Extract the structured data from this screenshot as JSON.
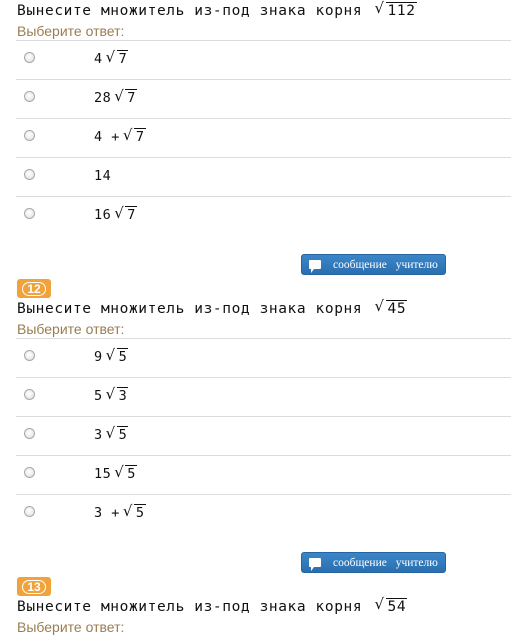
{
  "questions": [
    {
      "number": "",
      "text": "Вынесите множитель из-под знака корня",
      "radicand": "112",
      "hint": "Выберите ответ:",
      "answers": [
        {
          "prefix": "4",
          "op": "",
          "radicand": "7",
          "plain": ""
        },
        {
          "prefix": "28",
          "op": "",
          "radicand": "7",
          "plain": ""
        },
        {
          "prefix": "4",
          "op": "+",
          "radicand": "7",
          "plain": ""
        },
        {
          "prefix": "",
          "op": "",
          "radicand": "",
          "plain": "14"
        },
        {
          "prefix": "16",
          "op": "",
          "radicand": "7",
          "plain": ""
        }
      ],
      "message_button": "сообщение учителю"
    },
    {
      "number": "12",
      "text": "Вынесите множитель из-под знака корня",
      "radicand": "45",
      "hint": "Выберите ответ:",
      "answers": [
        {
          "prefix": "9",
          "op": "",
          "radicand": "5",
          "plain": ""
        },
        {
          "prefix": "5",
          "op": "",
          "radicand": "3",
          "plain": ""
        },
        {
          "prefix": "3",
          "op": "",
          "radicand": "5",
          "plain": ""
        },
        {
          "prefix": "15",
          "op": "",
          "radicand": "5",
          "plain": ""
        },
        {
          "prefix": "3",
          "op": "+",
          "radicand": "5",
          "plain": ""
        }
      ],
      "message_button": "сообщение учителю"
    },
    {
      "number": "13",
      "text": "Вынесите множитель из-под знака корня",
      "radicand": "54",
      "hint": "Выберите ответ:"
    }
  ],
  "colors": {
    "badge": "#f0a33a",
    "hint": "#9a7d52",
    "button": "#2a6fb0",
    "divider": "#dcdcdc"
  },
  "icons": {
    "message": "speech-bubble-icon",
    "radio": "radio-circle-icon"
  }
}
